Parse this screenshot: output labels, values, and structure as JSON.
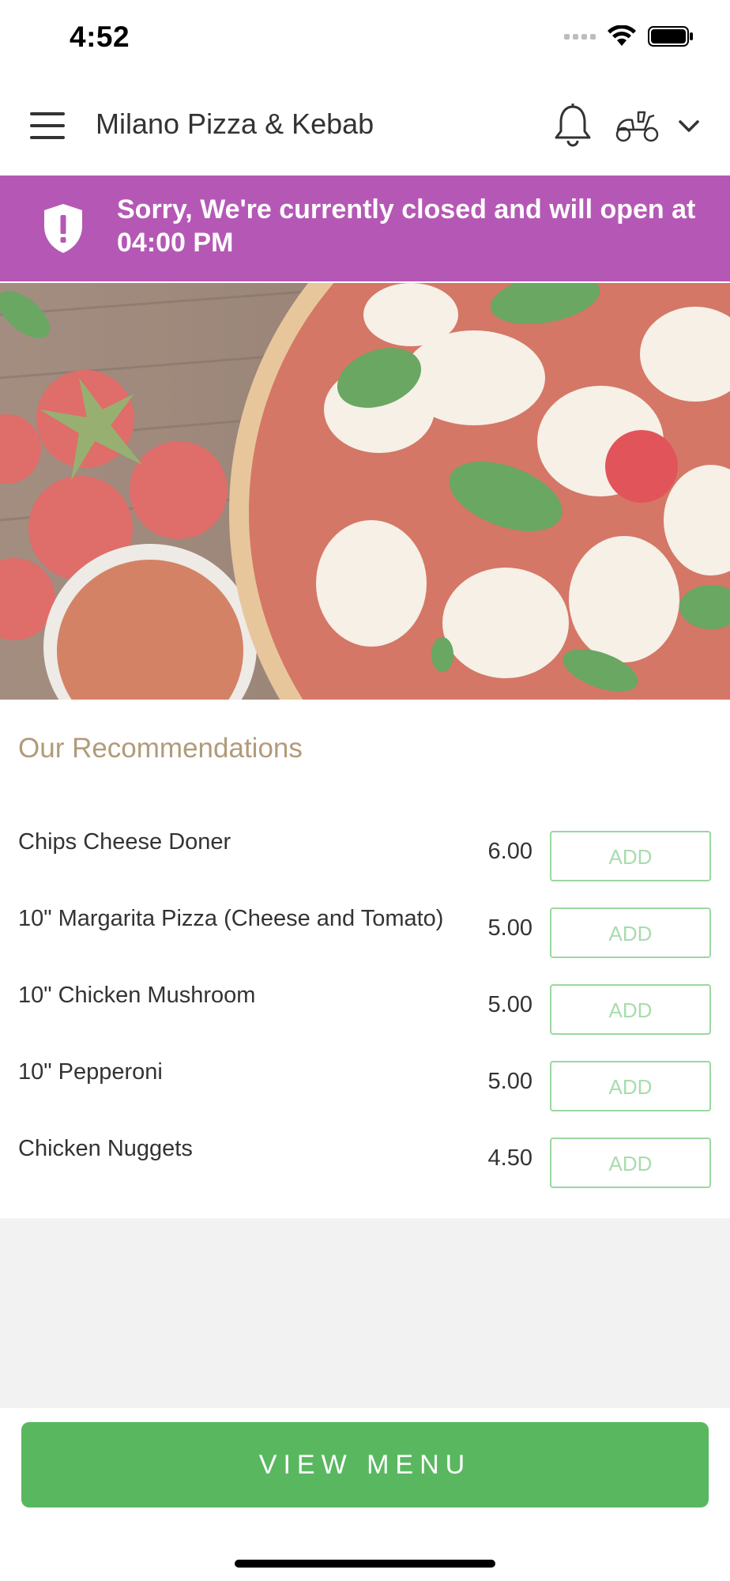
{
  "status_bar": {
    "time": "4:52",
    "battery_level": 1.0
  },
  "header": {
    "title": "Milano Pizza & Kebab",
    "icons": [
      "menu-icon",
      "bell-icon",
      "scooter-icon",
      "chevron-down-icon"
    ]
  },
  "banner": {
    "message": "Sorry, We're currently closed and will open at 04:00 PM",
    "color": "#b558b5",
    "icon": "shield-exclamation-icon"
  },
  "recommendations": {
    "title": "Our Recommendations",
    "add_label": "ADD",
    "items": [
      {
        "name": "Chips Cheese Doner",
        "price": "6.00"
      },
      {
        "name": "10\" Margarita Pizza (Cheese and Tomato)",
        "price": "5.00"
      },
      {
        "name": "10\" Chicken Mushroom",
        "price": "5.00"
      },
      {
        "name": "10\" Pepperoni",
        "price": "5.00"
      },
      {
        "name": "Chicken Nuggets",
        "price": "4.50"
      }
    ]
  },
  "footer": {
    "view_menu_label": "VIEW MENU",
    "accent": "#59b760"
  }
}
